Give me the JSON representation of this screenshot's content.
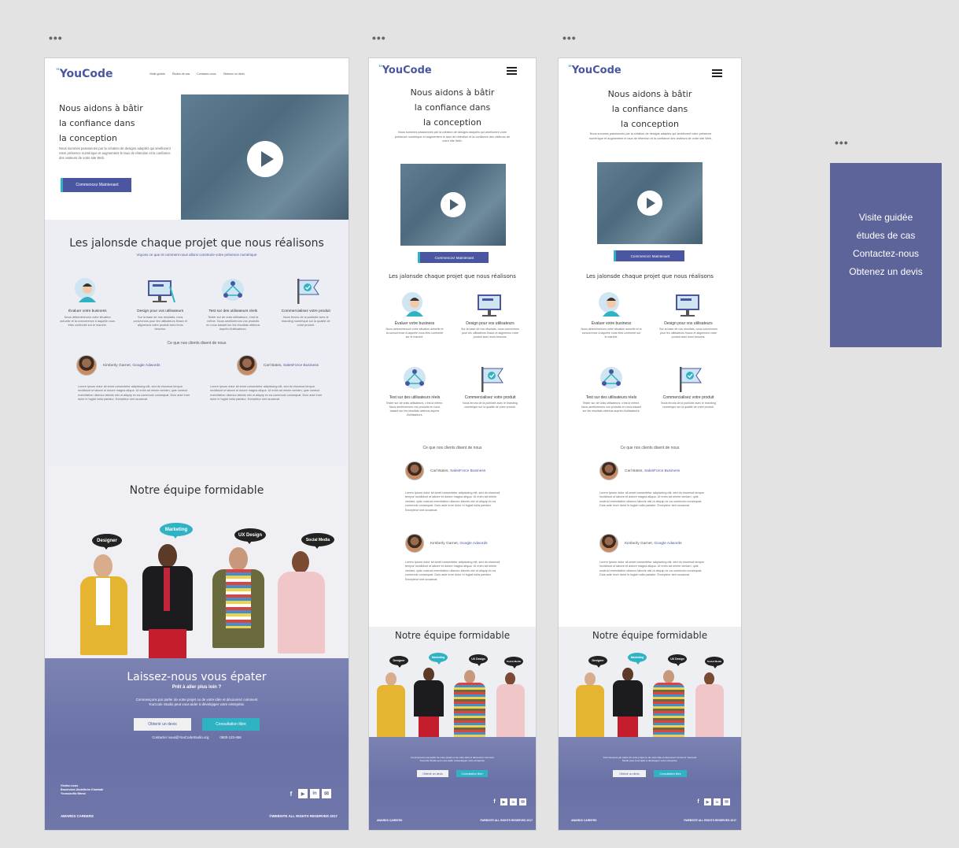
{
  "canvas": {
    "frame_dots": "•••"
  },
  "brand": {
    "logo": "YouCode",
    "tick": "\""
  },
  "desktop": {
    "nav": [
      "Visite guidée",
      "Études de cas",
      "Contactez-nous",
      "Obtenez un devis"
    ],
    "hero_title": [
      "Nous aidons à bâtir",
      "la confiance dans",
      "la conception"
    ],
    "hero_text": "Nous sommes passionnés par la création de designs adaptés qui améliorent votre présence numérique et augmentent le taux de rétention et la confiance des visiteurs de votre site Web.",
    "cta": "Commencez Maintenant",
    "milestones_title": "Les jalonsde chaque projet que nous réalisons",
    "milestones_sub": "Voyons ce que et comment nous allons construire votre présence numérique",
    "steps": [
      {
        "icon": "user-search-icon",
        "title": "Évaluer votre business",
        "desc": "Nous déterminerons votre situation actuelle et la concurrence à laquelle vous êtes confronté sur le marché."
      },
      {
        "icon": "monitor-design-icon",
        "title": "Design pour vos utilisateurs",
        "desc": "Sur la base de nos résultats, nous concevrons pour les utilisateurs finaux et alignerons votre produit avec leurs besoins."
      },
      {
        "icon": "user-network-icon",
        "title": "Test sur des utilisateurs réels",
        "desc": "Tester sur de vrais utilisateurs, c'est la même. Nous améliorerons vos produits en nous basant sur les résultats obtenus auprès d'utilisateurs."
      },
      {
        "icon": "flag-check-icon",
        "title": "Commercialisez votre produit",
        "desc": "Nous ferons de la publicité avec le branding numérique sur la qualité de votre produit."
      }
    ],
    "testimonials_head": "Ce que nos clients disent de nous",
    "testimonials": [
      {
        "name": "Kimberly Garnet, ",
        "company": "Google Adwords",
        "text": "Lorem Ipsum dolor sit amet consectetur adipisicing elit, sed do eiusmod tempor incididunt ut labore et dolore magna aliqua. Ut enim ad minim veniam, quis nostrud exercitation ullamco laboris nisi ut aliquip ex ea commodo consequat. Duis aute irure dolor in fugiat nulla pariatur. Excepteur sint occaecat."
      },
      {
        "name": "Carl Bates, ",
        "company": "SalesForce Business",
        "text": "Lorem Ipsum dolor sit amet consectetur adipisicing elit, sed do eiusmod tempor incididunt ut labore et dolore magna aliqua. Ut enim ad minim veniam, quis nostrud exercitation ullamco laboris nisi ut aliquip ex ea commodo consequat. Duis aute irure dolor in fugiat nulla pariatur. Excepteur sint occaecat."
      }
    ],
    "team_title": "Notre équipe formidable",
    "team_bubbles": [
      "Designer",
      "Marketing",
      "UX Design",
      "Social Media"
    ],
    "footer_title": "Laissez-nous vous épater",
    "footer_sub": "Prêt à aller plus loin ?",
    "footer_text": "Commençons par parler de votre projet ou de votre idée et découvrez comment YouCode Studio peut vous aider à développer votre entreprise.",
    "btn_quote": "Obtenir un devis",
    "btn_consult": "Consultation libre",
    "contact_line": "Contacter nous@YouCodeStudio.org",
    "phone": "0500-123-456",
    "address": [
      "Visitez-nous",
      "Boulevard Abdelkrim Khattabi",
      "Youssoufia Maroc"
    ],
    "social_icons": [
      "f",
      "▶",
      "in",
      "✉"
    ],
    "footer_links": "AWARDS   CAREERS",
    "copyright": "©WEBSITE ALL RIGHTS RESERVED 2017"
  },
  "mobile": {
    "milestones_title": "Les jalonsde chaque projet que nous réalisons",
    "steps": [
      {
        "title": "Évaluer votre business",
        "desc": "Nous déterminerons votre situation actuelle et la concurrence à laquelle vous êtes confronté sur le marché."
      },
      {
        "title": "Design pour vos utilisateurs",
        "desc": "Sur la base de nos résultats, nous concevrons pour les utilisateurs finaux et alignerons votre produit avec leurs besoins."
      },
      {
        "title": "Test sur des utilisateurs réels",
        "desc": "Tester sur de vrais utilisateurs, c'est la même. Nous améliorerons vos produits en nous basant sur les résultats obtenus auprès d'utilisateurs."
      },
      {
        "title": "Commercialisez votre produit",
        "desc": "Nous ferons de la publicité avec le branding numérique sur la qualité de votre produit."
      }
    ],
    "testimonials_head": "Ce que nos clients disent de nous",
    "t1_name": "Carl Bates, ",
    "t1_company": "SalesForce Business",
    "t2_name": "Kimberly Garnet, ",
    "t2_company": "Google Adwords",
    "team_title": "Notre équipe formidable",
    "team_bubbles": [
      "Designer",
      "Marketing",
      "UX Design",
      "Social Media"
    ],
    "btn_quote": "Obtenir un devis",
    "btn_consult": "Consultation libre",
    "footer_links": "AWARDS   CAREERS",
    "copyright": "©WEBSITE ALL RIGHTS RESERVED 2017"
  },
  "menu_panel": {
    "items": [
      "Visite guidée",
      "études de cas",
      "Contactez-nous",
      "Obtenez un devis"
    ]
  },
  "colors": {
    "brand": "#4a56a0",
    "accent": "#2fb3c4",
    "footer": "#6a71a6",
    "menu_panel": "#5d6499"
  }
}
